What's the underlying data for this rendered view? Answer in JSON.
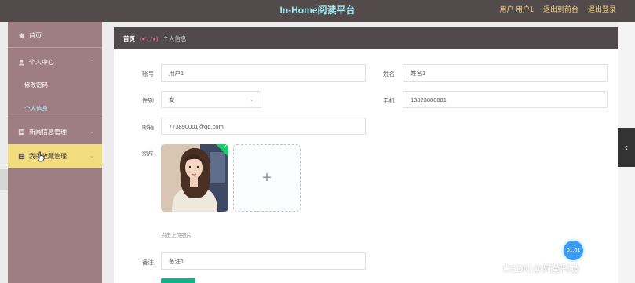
{
  "header": {
    "title": "In-Home阅读平台",
    "user_label": "用户 用户1",
    "back_to_front": "退出到前台",
    "logout": "退出登录"
  },
  "sidebar": {
    "home": "首页",
    "personal_center": "个人中心",
    "change_password": "修改密码",
    "personal_info": "个人信息",
    "news_management": "新闻信息管理",
    "favorites_management": "我的收藏管理"
  },
  "breadcrumb": {
    "home": "首页",
    "separator": "(●'◡'●)",
    "current": "个人信息"
  },
  "form": {
    "account_label": "账号",
    "account_value": "用户1",
    "name_label": "姓名",
    "name_value": "姓名1",
    "gender_label": "性别",
    "gender_value": "女",
    "phone_label": "手机",
    "phone_value": "13823888881",
    "email_label": "邮箱",
    "email_value": "773890001@qq.com",
    "photo_label": "照片",
    "upload_plus": "+",
    "upload_hint": "点击上传照片",
    "note_label": "备注",
    "note_value": "备注1"
  },
  "widgets": {
    "time_badge": "01:01",
    "side_tab_icon": "chevron-left-icon",
    "watermark": "CSDN @阿莫科技"
  },
  "colors": {
    "header_bg": "#534a4c",
    "title": "#9fe7ec",
    "sidebar_bg": "#9f7e83",
    "sidebar_active": "#f1dc80",
    "breadcrumb_bg": "#514a4c",
    "accent_green": "#13b38a"
  }
}
